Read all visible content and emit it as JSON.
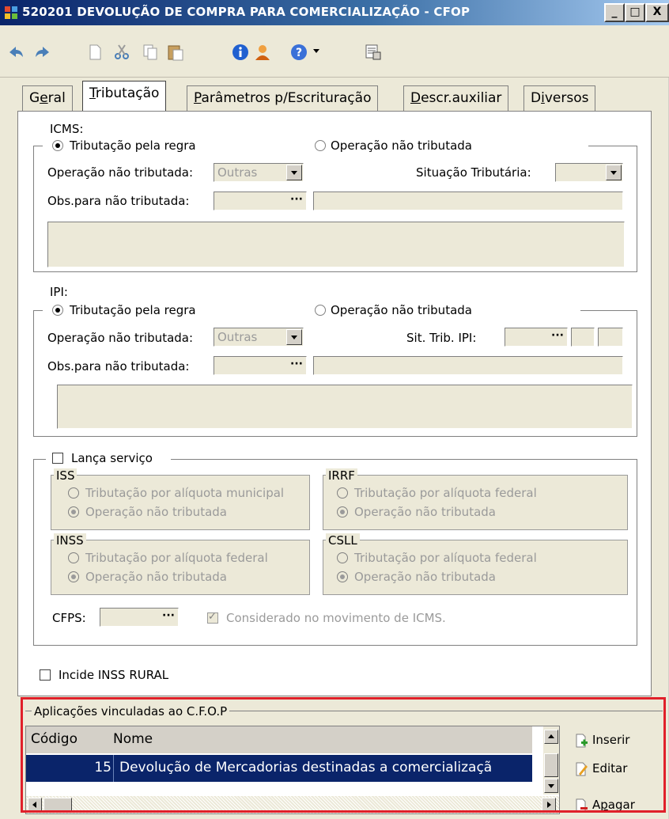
{
  "window": {
    "title": "520201 DEVOLUÇÃO DE COMPRA PARA COMERCIALIZAÇÃO - CFOP",
    "buttons": [
      "_",
      "□",
      "X"
    ]
  },
  "toolbar": {
    "icons": [
      "undo-icon",
      "redo-icon",
      "new-icon",
      "cut-icon",
      "copy-icon",
      "paste-icon",
      "info-icon",
      "user-icon",
      "help-icon",
      "print-preview-icon"
    ]
  },
  "tabs": [
    {
      "label_pre": "G",
      "label_u": "e",
      "label_post": "ral"
    },
    {
      "label_pre": "",
      "label_u": "T",
      "label_post": "ributação"
    },
    {
      "label_pre": "",
      "label_u": "P",
      "label_post": "arâmetros p/Escrituração"
    },
    {
      "label_pre": "",
      "label_u": "D",
      "label_post": "escr.auxiliar"
    },
    {
      "label_pre": "D",
      "label_u": "i",
      "label_post": "versos"
    }
  ],
  "icms": {
    "title": "ICMS:",
    "radio_regra": "Tributação pela regra",
    "radio_nao_trib": "Operação não tributada",
    "op_nao_trib_label": "Operação não tributada:",
    "op_nao_trib_value": "Outras",
    "situacao_label": "Situação Tributária:",
    "obs_label": "Obs.para não tributada:",
    "ellipsis": "···"
  },
  "ipi": {
    "title": "IPI:",
    "radio_regra": "Tributação pela regra",
    "radio_nao_trib": "Operação não tributada",
    "op_nao_trib_label": "Operação não tributada:",
    "op_nao_trib_value": "Outras",
    "sit_trib_label": "Sit. Trib. IPI:",
    "obs_label": "Obs.para não tributada:",
    "ellipsis": "···"
  },
  "servico": {
    "checkbox_label": "Lança serviço",
    "iss": {
      "title": "ISS",
      "opt1": "Tributação por alíquota municipal",
      "opt2": "Operação não tributada"
    },
    "irrf": {
      "title": "IRRF",
      "opt1": "Tributação por alíquota federal",
      "opt2": "Operação não tributada"
    },
    "inss": {
      "title": "INSS",
      "opt1": "Tributação por alíquota federal",
      "opt2": "Operação não tributada"
    },
    "csll": {
      "title": "CSLL",
      "opt1": "Tributação por alíquota federal",
      "opt2": "Operação não tributada"
    },
    "cfps_label": "CFPS:",
    "cfps_ellipsis": "···",
    "considerado_label": "Considerado no movimento de ICMS."
  },
  "inss_rural_label": "Incide INSS RURAL",
  "aplicacoes": {
    "title": "Aplicações vinculadas ao C.F.O.P",
    "columns": [
      "Código",
      "Nome"
    ],
    "rows": [
      {
        "codigo": "15",
        "nome": "Devolução de Mercadorias destinadas a comercializaçã"
      }
    ],
    "buttons": {
      "inserir": "Inserir",
      "editar": "Editar",
      "apagar_pre": "A",
      "apagar_u": "p",
      "apagar_post": "agar"
    }
  },
  "colors": {
    "title_bar": "#0a246a",
    "highlight": "#e0202a",
    "selection": "#0a246a"
  }
}
